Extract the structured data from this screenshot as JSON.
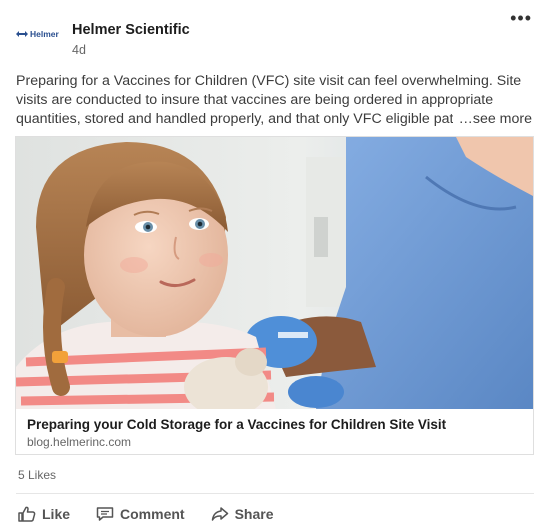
{
  "post": {
    "author": "Helmer Scientific",
    "logo_text": "Helmer",
    "timestamp": "4d",
    "more_icon": "•••",
    "body_lines": [
      "Preparing for a Vaccines for Children (VFC) site visit can feel overwhelming. Site",
      "visits are conducted to insure that vaccines are being ordered in appropriate",
      "quantities, stored and handled properly, and that only VFC eligible pat"
    ],
    "see_more": "…see more"
  },
  "link_card": {
    "title": "Preparing your Cold Storage for a Vaccines for Children Site Visit",
    "domain": "blog.helmerinc.com"
  },
  "stats": {
    "likes": "5 Likes"
  },
  "actions": {
    "like": "Like",
    "comment": "Comment",
    "share": "Share"
  },
  "icons": [
    "more-icon",
    "like-icon",
    "comment-icon",
    "share-icon"
  ],
  "colors": {
    "brand": "#2a4f8f",
    "scrubs": "#6d9bd6",
    "glove": "#4f8fd8"
  }
}
